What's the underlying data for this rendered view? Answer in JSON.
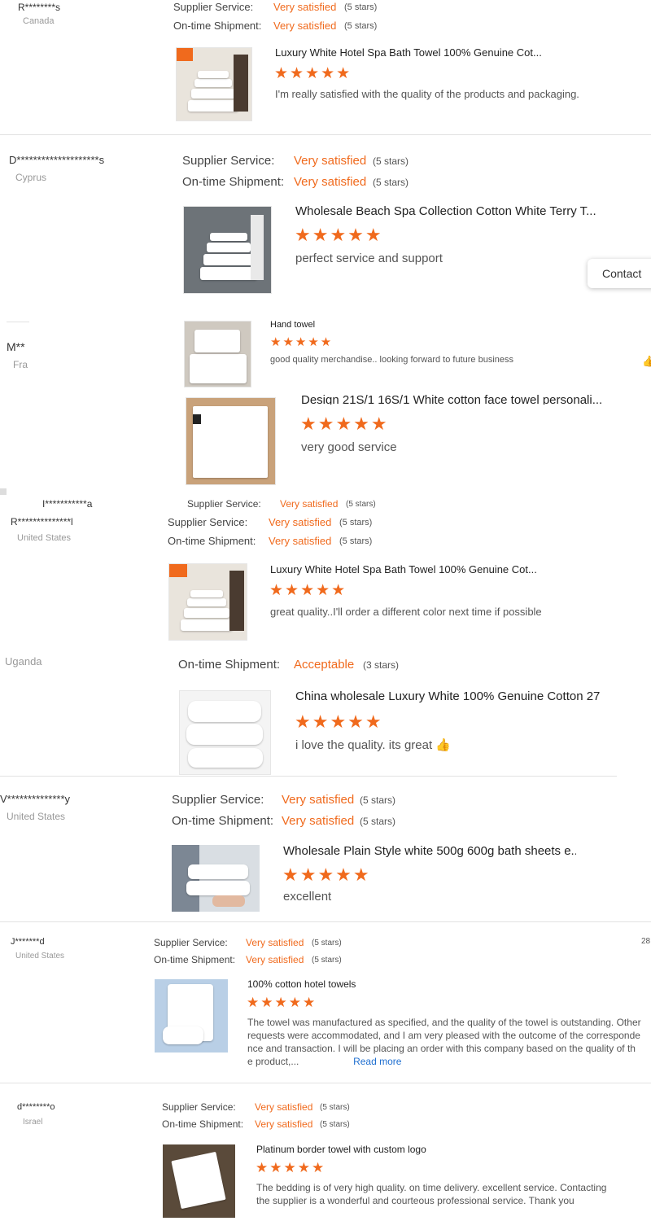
{
  "labels": {
    "supplier_service": "Supplier Service:",
    "ontime_shipment": "On-time Shipment:"
  },
  "accent_color": "#f06a1d",
  "star_glyph": "★★★★★",
  "reviews": [
    {
      "name": "R********s",
      "country": "Canada",
      "supplier_value": "Very satisfied",
      "supplier_note": "(5 stars)",
      "shipment_value": "Very satisfied",
      "shipment_note": "(5 stars)",
      "product": "Luxury White Hotel Spa Bath Towel 100% Genuine Cot...",
      "rating": 5,
      "comment": "I'm really satisfied with the quality of the products and packaging."
    },
    {
      "name": "D********************s",
      "country": "Cyprus",
      "supplier_value": "Very satisfied",
      "supplier_note": "(5 stars)",
      "shipment_value": "Very satisfied",
      "shipment_note": "(5 stars)",
      "product": "Wholesale Beach Spa Collection Cotton White Terry T...",
      "rating": 5,
      "comment": "perfect service and support"
    },
    {
      "name": "M**",
      "country": "Fra",
      "product": "Hand towel",
      "rating": 5,
      "comment": "good quality merchandise.. looking forward to future business"
    },
    {
      "product": "Design 21S/1 16S/1 White cotton face towel personali...",
      "rating": 5,
      "comment": "very good service"
    },
    {
      "name": "I***********a",
      "supplier_value": "Very satisfied",
      "supplier_note": "(5 stars)"
    },
    {
      "name": "R**************l",
      "country": "United States",
      "supplier_value": "Very satisfied",
      "supplier_note": "(5 stars)",
      "shipment_value": "Very satisfied",
      "shipment_note": "(5 stars)",
      "product": "Luxury White Hotel Spa Bath Towel 100% Genuine Cot...",
      "rating": 5,
      "comment": "great quality..I'll order a different color next time if possible"
    },
    {
      "country": "Uganda",
      "shipment_value": "Acceptable",
      "shipment_note": "(3 stars)",
      "product": "China wholesale Luxury White 100% Genuine Cotton 27",
      "rating": 5,
      "comment": "i love the quality. its great 👍"
    },
    {
      "name": "V**************y",
      "country": "United States",
      "supplier_value": "Very satisfied",
      "supplier_note": "(5 stars)",
      "shipment_value": "Very satisfied",
      "shipment_note": "(5 stars)",
      "product": "Wholesale Plain Style white 500g 600g bath sheets e...",
      "rating": 5,
      "comment": "excellent"
    },
    {
      "name": "J*******d",
      "country": "United States",
      "supplier_value": "Very satisfied",
      "supplier_note": "(5 stars)",
      "shipment_value": "Very satisfied",
      "shipment_note": "(5 stars)",
      "product": "100% cotton hotel towels",
      "rating": 5,
      "comment_lines": [
        "The towel was manufactured as specified, and the quality of the towel is outstanding. Other",
        "requests were accommodated, and I am very pleased with the outcome of the corresponde",
        "nce and transaction.  I will be placing an order with this company based on the quality of th",
        "e product,..."
      ],
      "read_more": "Read more",
      "side_number": "28"
    },
    {
      "name": "d********o",
      "country": "Israel",
      "supplier_value": "Very satisfied",
      "supplier_note": "(5 stars)",
      "shipment_value": "Very satisfied",
      "shipment_note": "(5 stars)",
      "product": "Platinum border towel with custom logo",
      "rating": 5,
      "comment_lines": [
        "The bedding is of very high quality. on time delivery. excellent service. Contacting",
        "the supplier is a wonderful and courteous professional service. Thank you"
      ]
    }
  ],
  "contact_button": "Contact"
}
